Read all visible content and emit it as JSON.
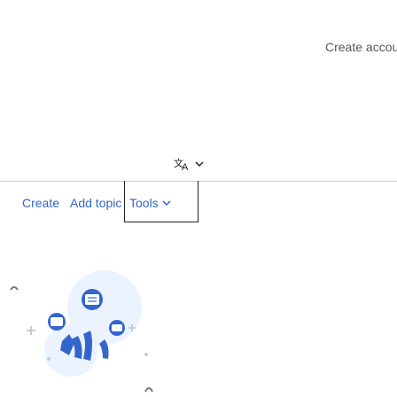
{
  "header": {
    "create_account_label": "Create account",
    "language_icon": "translate-icon"
  },
  "tabs": {
    "create_label": "Create",
    "add_topic_label": "Add topic",
    "tools_label": "Tools"
  },
  "colors": {
    "link": "#3366cc",
    "muted_text": "#54595d",
    "rule": "#c8ccd1",
    "illustration_blue": "#36c",
    "illustration_light": "#eaf3ff"
  },
  "icons": [
    "translate-icon",
    "chevron-down-icon",
    "talk-illustration"
  ]
}
